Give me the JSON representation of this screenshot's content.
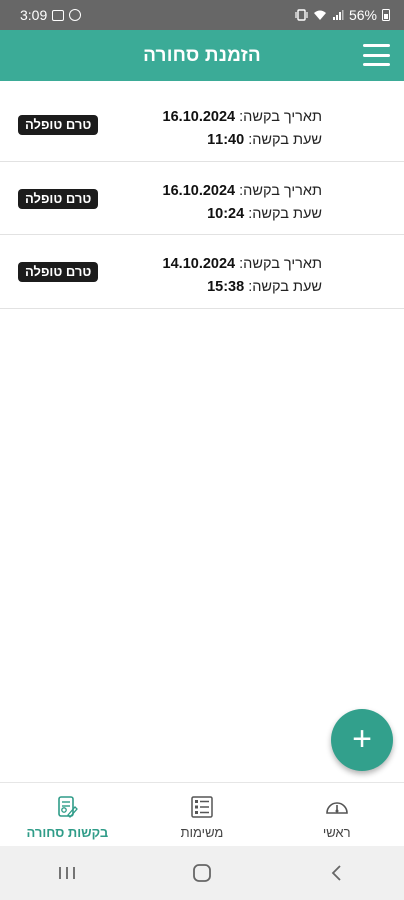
{
  "status_bar": {
    "time": "3:09",
    "battery": "56%"
  },
  "app_bar": {
    "title": "הזמנת סחורה"
  },
  "requests": [
    {
      "date_label": "תאריך בקשה:",
      "date": "16.10.2024",
      "time_label": "שעת בקשה:",
      "time": "11:40",
      "status": "טרם טופלה"
    },
    {
      "date_label": "תאריך בקשה:",
      "date": "16.10.2024",
      "time_label": "שעת בקשה:",
      "time": "10:24",
      "status": "טרם טופלה"
    },
    {
      "date_label": "תאריך בקשה:",
      "date": "14.10.2024",
      "time_label": "שעת בקשה:",
      "time": "15:38",
      "status": "טרם טופלה"
    }
  ],
  "fab": {
    "symbol": "+"
  },
  "bottom_nav": {
    "items": [
      {
        "label": "בקשות סחורה",
        "icon": "goods-request-icon"
      },
      {
        "label": "משימות",
        "icon": "tasks-icon"
      },
      {
        "label": "ראשי",
        "icon": "dashboard-gauge-icon"
      }
    ],
    "active_index": 0
  },
  "colors": {
    "primary": "#3bab97",
    "fab": "#32a08c",
    "badge": "#1c1c1c",
    "active_nav": "#2f9c88"
  }
}
